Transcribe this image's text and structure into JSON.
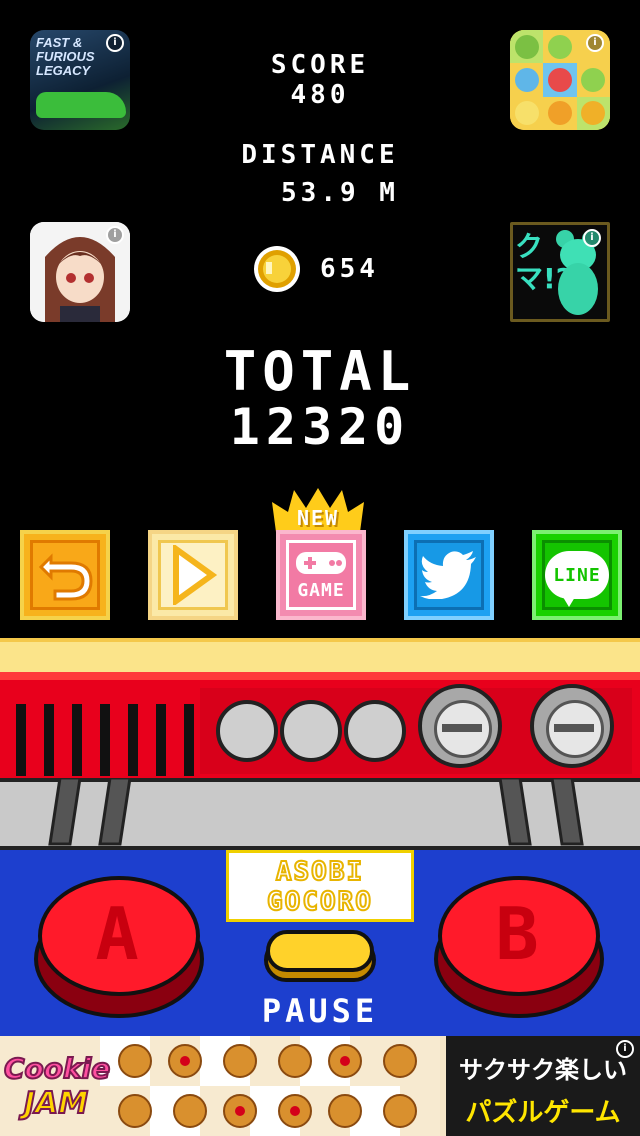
{
  "stats": {
    "score_label": "SCORE",
    "score_value": "480",
    "distance_label": "DISTANCE",
    "distance_value": "53.9 M",
    "coins_value": "654",
    "total_label": "TOTAL",
    "total_value": "12320"
  },
  "ads": {
    "top_left_text": "FAST & FURIOUS LEGACY",
    "info_symbol": "i",
    "kuma_text": "クマ!?"
  },
  "buttons": {
    "new_badge": "NEW",
    "game_label": "GAME",
    "line_label": "LINE"
  },
  "controller": {
    "logo_line1": "ASOBI",
    "logo_line2": "GOCORO",
    "pause_label": "PAUSE",
    "a_label": "A",
    "b_label": "B"
  },
  "bottom_banner": {
    "brand_line1": "Cookie",
    "brand_line2": "JAM",
    "jp_line1": "サクサク楽しい",
    "jp_line2": "パズルゲーム"
  },
  "colors": {
    "replay": "#f7b21c",
    "play": "#fbe9a7",
    "game": "#f38bb0",
    "twitter": "#1da1f2",
    "line": "#19d100",
    "red_panel": "#e8001c",
    "blue_panel": "#1d3fce",
    "stripe_yellow": "#fbe48a"
  }
}
